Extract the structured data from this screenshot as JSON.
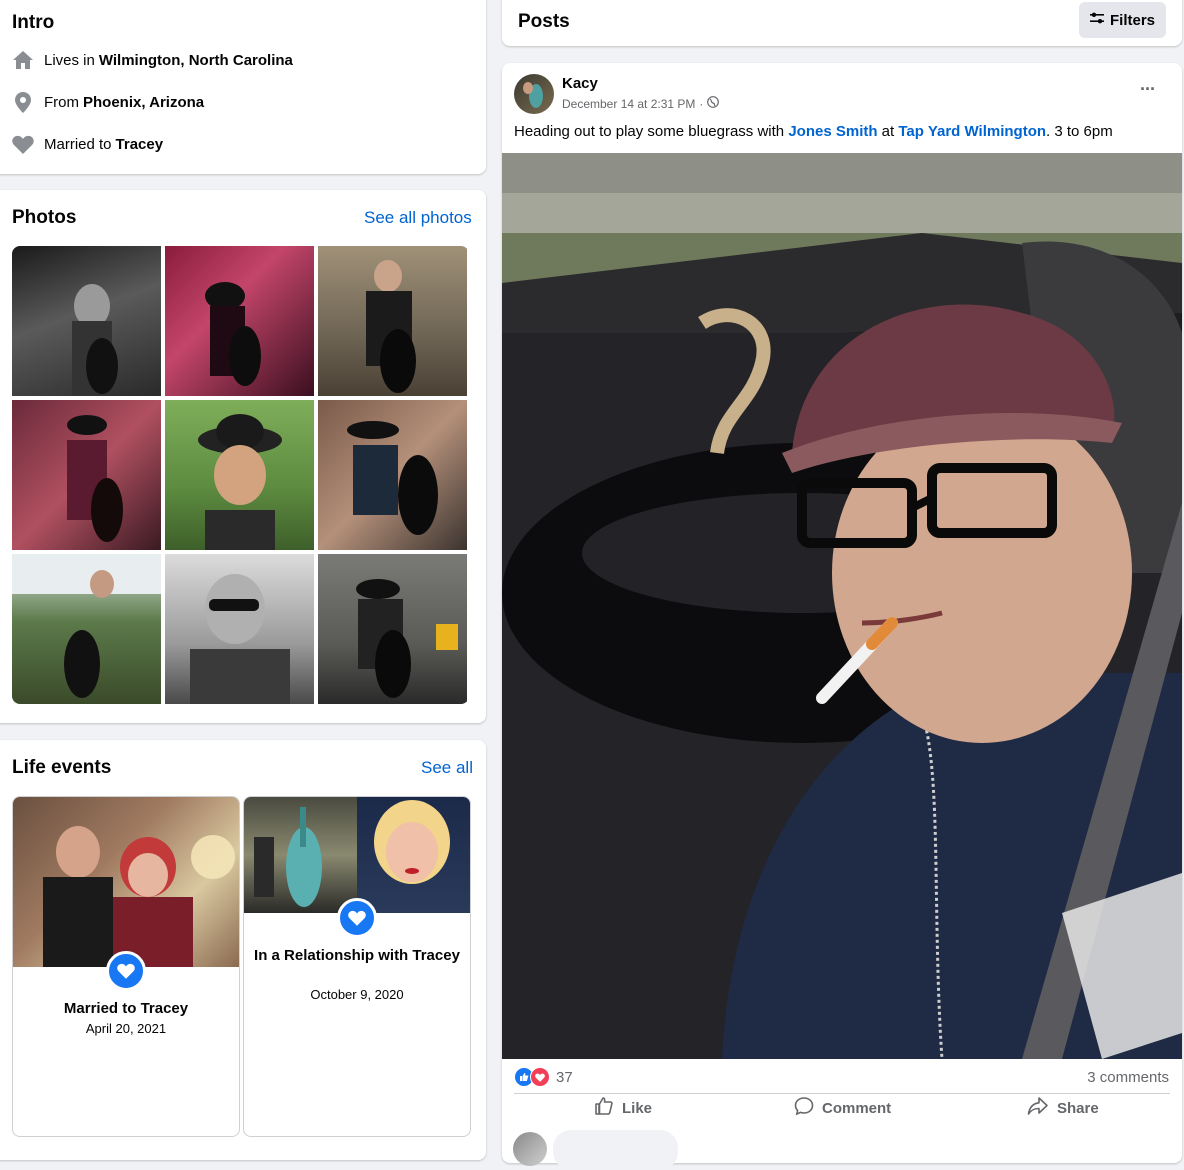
{
  "intro": {
    "title": "Intro",
    "rows": [
      {
        "prefix": "Lives in",
        "value": "Wilmington, North Carolina",
        "icon": "home-icon"
      },
      {
        "prefix": "From",
        "value": "Phoenix, Arizona",
        "icon": "location-pin-icon"
      },
      {
        "prefix": "Married to",
        "value": "Tracey",
        "icon": "heart-icon"
      }
    ]
  },
  "photos": {
    "title": "Photos",
    "see_all": "See all photos"
  },
  "life_events": {
    "title": "Life events",
    "see_all": "See all",
    "events": [
      {
        "title": "Married to Tracey",
        "date": "April 20, 2021"
      },
      {
        "title": "In a Relationship with Tracey",
        "date": "October 9, 2020"
      }
    ]
  },
  "posts": {
    "title": "Posts",
    "filters_label": "Filters"
  },
  "post": {
    "author": "Kacy",
    "date": "December 14 at 2:31 PM",
    "separator": "·",
    "text_before": "Heading out to play some bluegrass with ",
    "mention1": "Jones Smith",
    "text_middle": " at ",
    "mention2": "Tap Yard Wilmington",
    "text_after": ". 3 to 6pm",
    "reaction_count": "37",
    "comments": "3 comments",
    "actions": {
      "like": "Like",
      "comment": "Comment",
      "share": "Share"
    },
    "more": "···"
  },
  "colors": {
    "accent": "#1877f2",
    "link": "#0064d1",
    "background": "#f0f2f5",
    "secondary_text": "#65676b"
  }
}
